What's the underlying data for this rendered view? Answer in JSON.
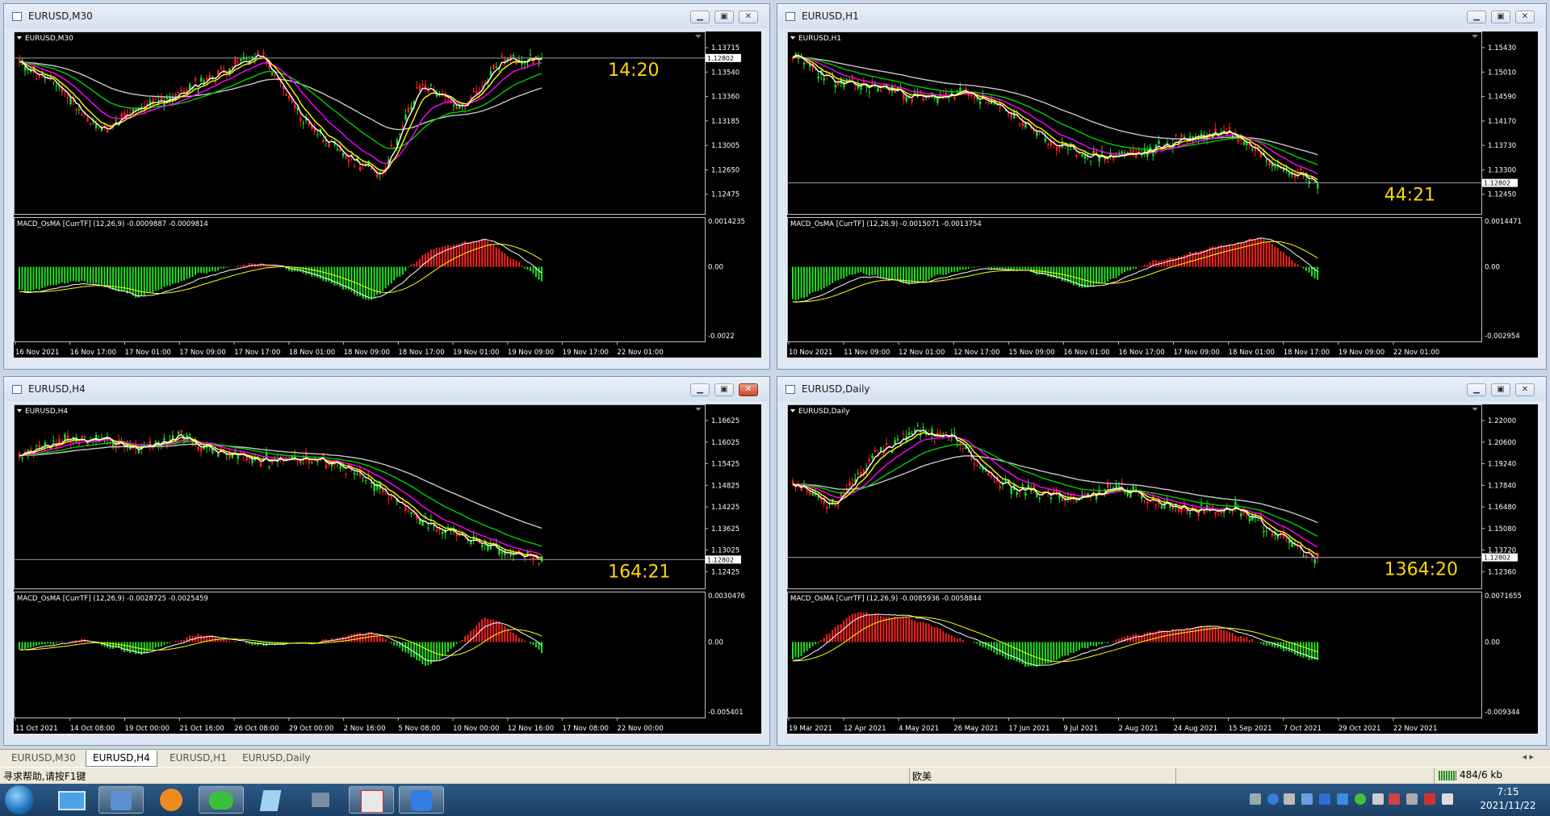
{
  "windows": [
    {
      "id": "m30",
      "title": "EURUSD,M30",
      "symbol": "EURUSD,M30",
      "prices": [
        "1.13715",
        "1.13540",
        "1.13360",
        "1.13185",
        "1.13005",
        "1.12650",
        "1.12475"
      ],
      "current_price": "1.12802",
      "timer": "14:20",
      "macd_label": "MACD_OsMA [CurrTF] (12,26,9) -0.0009887 -0.0009814",
      "macd_ticks": [
        "0.0014235",
        "0.00",
        "-0.0022"
      ],
      "time_labels": [
        "16 Nov 2021",
        "16 Nov 17:00",
        "17 Nov 01:00",
        "17 Nov 09:00",
        "17 Nov 17:00",
        "18 Nov 01:00",
        "18 Nov 09:00",
        "18 Nov 17:00",
        "19 Nov 01:00",
        "19 Nov 09:00",
        "19 Nov 17:00",
        "22 Nov 01:00"
      ]
    },
    {
      "id": "h1",
      "title": "EURUSD,H1",
      "symbol": "EURUSD,H1",
      "prices": [
        "1.15430",
        "1.15010",
        "1.14590",
        "1.14170",
        "1.13730",
        "1.13300",
        "1.12450"
      ],
      "current_price": "1.12802",
      "timer": "44:21",
      "macd_label": "MACD_OsMA [CurrTF] (12,26,9) -0.0015071 -0.0013754",
      "macd_ticks": [
        "0.0014471",
        "0.00",
        "-0.002954"
      ],
      "time_labels": [
        "10 Nov 2021",
        "11 Nov 09:00",
        "12 Nov 01:00",
        "12 Nov 17:00",
        "15 Nov 09:00",
        "16 Nov 01:00",
        "16 Nov 17:00",
        "17 Nov 09:00",
        "18 Nov 01:00",
        "18 Nov 17:00",
        "19 Nov 09:00",
        "22 Nov 01:00"
      ]
    },
    {
      "id": "h4",
      "title": "EURUSD,H4",
      "symbol": "EURUSD,H4",
      "prices": [
        "1.16625",
        "1.16025",
        "1.15425",
        "1.14825",
        "1.14225",
        "1.13625",
        "1.13025",
        "1.12425"
      ],
      "current_price": "1.12802",
      "timer": "164:21",
      "macd_label": "MACD_OsMA [CurrTF] (12,26,9) -0.0028725 -0.0025459",
      "macd_ticks": [
        "0.0030476",
        "0.00",
        "-0.005401"
      ],
      "time_labels": [
        "11 Oct 2021",
        "14 Oct 08:00",
        "19 Oct 00:00",
        "21 Oct 16:00",
        "26 Oct 08:00",
        "29 Oct 00:00",
        "2 Nov 16:00",
        "5 Nov 08:00",
        "10 Nov 00:00",
        "12 Nov 16:00",
        "17 Nov 08:00",
        "22 Nov 00:00"
      ]
    },
    {
      "id": "d1",
      "title": "EURUSD,Daily",
      "symbol": "EURUSD,Daily",
      "prices": [
        "1.22000",
        "1.20600",
        "1.19240",
        "1.17840",
        "1.16480",
        "1.15080",
        "1.13720",
        "1.12360"
      ],
      "current_price": "1.12802",
      "timer": "1364:20",
      "macd_label": "MACD_OsMA [CurrTF] (12,26,9) -0.0085936 -0.0058844",
      "macd_ticks": [
        "0.0071655",
        "0.00",
        "-0.009344"
      ],
      "time_labels": [
        "19 Mar 2021",
        "12 Apr 2021",
        "4 May 2021",
        "26 May 2021",
        "17 Jun 2021",
        "9 Jul 2021",
        "2 Aug 2021",
        "24 Aug 2021",
        "15 Sep 2021",
        "7 Oct 2021",
        "29 Oct 2021",
        "22 Nov 2021"
      ]
    }
  ],
  "tabs": [
    "EURUSD,M30",
    "EURUSD,H4",
    "EURUSD,H1",
    "EURUSD,Daily"
  ],
  "active_tab": "EURUSD,H4",
  "status": {
    "help": "寻求帮助,请按F1键",
    "profile": "欧美",
    "traffic": "484/6 kb"
  },
  "clock": {
    "time": "7:15",
    "date": "2021/11/22"
  },
  "colors": {
    "up": "#ff2020",
    "down": "#20e020",
    "ma_fast": "#ffffff",
    "ma_yellow": "#ffff00",
    "ma_magenta": "#ff00ff",
    "ma_green": "#00cc00",
    "ma_gray": "#c8c8c8",
    "timer": "#ffd700",
    "macd_line": "#ffffff",
    "signal_line": "#ffff00"
  }
}
